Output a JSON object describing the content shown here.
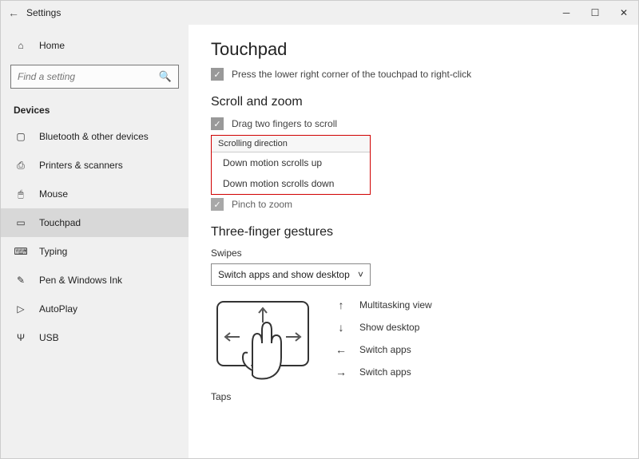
{
  "titlebar": {
    "title": "Settings"
  },
  "sidebar": {
    "home": "Home",
    "search_placeholder": "Find a setting",
    "group": "Devices",
    "items": [
      {
        "id": "bluetooth",
        "label": "Bluetooth & other devices"
      },
      {
        "id": "printers",
        "label": "Printers & scanners"
      },
      {
        "id": "mouse",
        "label": "Mouse"
      },
      {
        "id": "touchpad",
        "label": "Touchpad",
        "selected": true
      },
      {
        "id": "typing",
        "label": "Typing"
      },
      {
        "id": "pen",
        "label": "Pen & Windows Ink"
      },
      {
        "id": "autoplay",
        "label": "AutoPlay"
      },
      {
        "id": "usb",
        "label": "USB"
      }
    ]
  },
  "main": {
    "title": "Touchpad",
    "press_corner": "Press the lower right corner of the touchpad to right-click",
    "scroll_zoom_header": "Scroll and zoom",
    "drag_two": "Drag two fingers to scroll",
    "scrolling_direction_label": "Scrolling direction",
    "scroll_options": [
      "Down motion scrolls up",
      "Down motion scrolls down"
    ],
    "pinch": "Pinch to zoom",
    "three_finger_header": "Three-finger gestures",
    "swipes_label": "Swipes",
    "swipes_value": "Switch apps and show desktop",
    "gestures": [
      {
        "arrow": "↑",
        "label": "Multitasking view"
      },
      {
        "arrow": "↓",
        "label": "Show desktop"
      },
      {
        "arrow": "←",
        "label": "Switch apps"
      },
      {
        "arrow": "→",
        "label": "Switch apps"
      }
    ],
    "taps_label": "Taps"
  }
}
